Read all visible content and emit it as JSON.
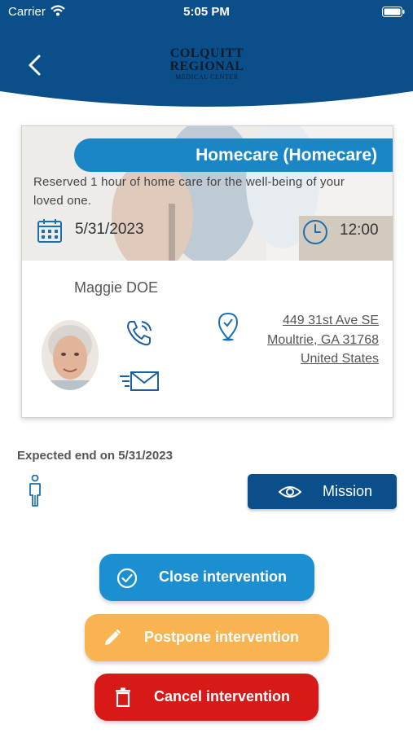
{
  "status_bar": {
    "carrier": "Carrier",
    "time": "5:05 PM"
  },
  "header": {
    "logo_line1": "COLQUITT",
    "logo_line2": "REGIONAL",
    "logo_line3": "MEDICAL CENTER",
    "background_color": "#0b4f8a"
  },
  "card": {
    "title": "Homecare (Homecare)",
    "description": "Reserved 1 hour of home care for the well-being of your loved one.",
    "date": "5/31/2023",
    "time": "12:00",
    "patient_name": "Maggie DOE",
    "address": {
      "line1": "449 31st Ave SE",
      "line2": "Moultrie, GA 31768",
      "line3": "United States"
    },
    "icons": [
      "calendar-icon",
      "clock-icon",
      "phone-icon",
      "mail-icon",
      "location-pin-icon"
    ]
  },
  "expected_end": "Expected end on 5/31/2023",
  "mission_button": {
    "label": "Mission",
    "color": "#0b4f8a"
  },
  "actions": {
    "close": {
      "label": "Close intervention",
      "color": "#1b8fd0"
    },
    "postpone": {
      "label": "Postpone intervention",
      "color": "#f7b450"
    },
    "cancel": {
      "label": "Cancel intervention",
      "color": "#d71a18"
    }
  }
}
